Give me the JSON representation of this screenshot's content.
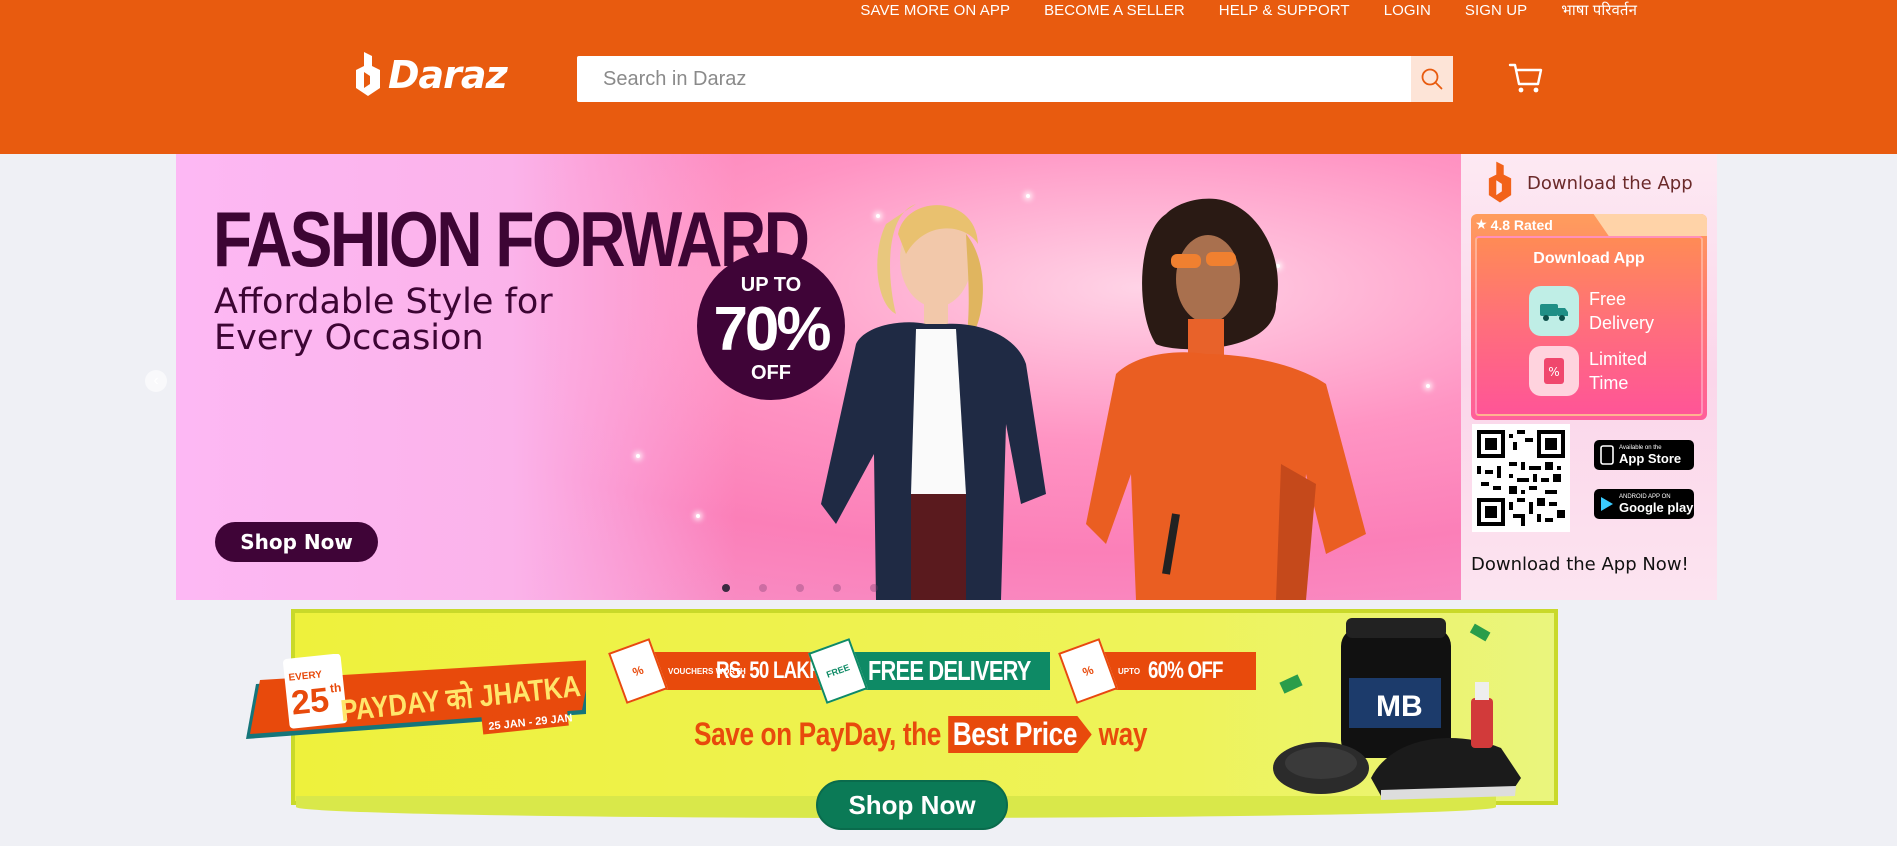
{
  "topnav": {
    "items": [
      "SAVE MORE ON APP",
      "BECOME A SELLER",
      "HELP & SUPPORT",
      "LOGIN",
      "SIGN UP",
      "भाषा परिवर्तन"
    ]
  },
  "brand": {
    "logo_text": "Daraz",
    "color": "#e85b0f"
  },
  "search": {
    "placeholder": "Search in Daraz",
    "icon": "search-icon"
  },
  "cart": {
    "icon": "cart-icon"
  },
  "hero": {
    "title": "FASHION FORWARD",
    "subtitle": "Affordable Style for Every Occasion",
    "badge": {
      "line1": "UP TO",
      "line2": "70%",
      "line3": "OFF"
    },
    "cta": "Shop Now",
    "slide_count": 5,
    "active_slide": 1
  },
  "app_panel": {
    "heading": "Download the App",
    "rating": "4.8 Rated",
    "card_title": "Download App",
    "features": [
      "Free Delivery",
      "Limited Time"
    ],
    "app_store": {
      "small": "Available on the",
      "big": "App Store"
    },
    "google_play": {
      "small": "ANDROID APP ON",
      "big": "Google play"
    },
    "footer": "Download the App Now!"
  },
  "payday_banner": {
    "every": "EVERY",
    "day": "25",
    "day_suffix": "th",
    "name": "PAYDAY को JHATKA",
    "dates": "25 JAN - 29 JAN",
    "chips": [
      {
        "tag": "%",
        "small": "VOUCHERS WORTH",
        "big": "RS. 50 LAKHS"
      },
      {
        "tag": "FREE",
        "small": "",
        "big": "FREE DELIVERY"
      },
      {
        "tag": "%",
        "small": "UPTO",
        "big": "60% OFF"
      }
    ],
    "headline_pre": "Save on PayDay, the",
    "headline_best": "Best Price",
    "headline_post": "way",
    "cta": "Shop Now",
    "product_label": "MB"
  }
}
